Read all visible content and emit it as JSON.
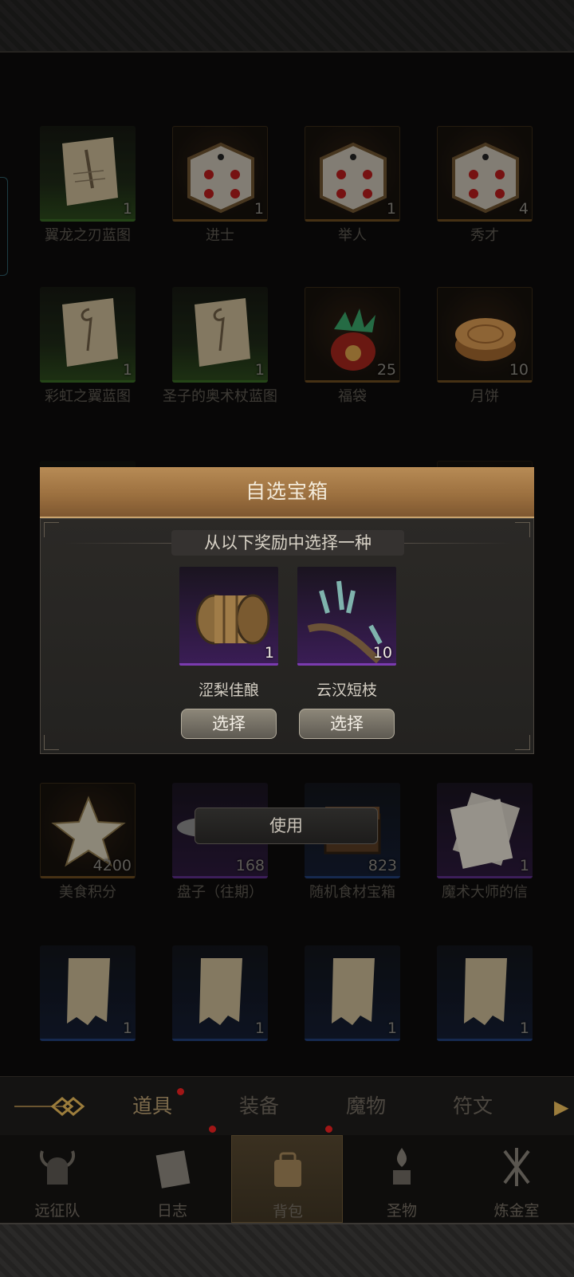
{
  "grid": {
    "items": [
      {
        "name": "翼龙之刃蓝图",
        "count": "1",
        "rarity": "green",
        "icon": "scroll-icon"
      },
      {
        "name": "进士",
        "count": "1",
        "rarity": "gold",
        "icon": "dice-icon"
      },
      {
        "name": "举人",
        "count": "1",
        "rarity": "gold",
        "icon": "dice-icon"
      },
      {
        "name": "秀才",
        "count": "4",
        "rarity": "gold",
        "icon": "dice-icon"
      },
      {
        "name": "彩虹之翼蓝图",
        "count": "1",
        "rarity": "green",
        "icon": "scroll-icon"
      },
      {
        "name": "圣子的奥术杖蓝图",
        "count": "1",
        "rarity": "green",
        "icon": "scroll-icon"
      },
      {
        "name": "福袋",
        "count": "25",
        "rarity": "gold",
        "icon": "lucky-bag-icon"
      },
      {
        "name": "月饼",
        "count": "10",
        "rarity": "gold",
        "icon": "mooncake-icon"
      },
      {
        "name": "美食积分",
        "count": "4200",
        "rarity": "gold",
        "icon": "star-icon"
      },
      {
        "name": "盘子（往期）",
        "count": "168",
        "rarity": "purple",
        "icon": "plate-icon"
      },
      {
        "name": "随机食材宝箱",
        "count": "823",
        "rarity": "blue",
        "icon": "chest-icon"
      },
      {
        "name": "魔术大师的信",
        "count": "1",
        "rarity": "purple",
        "icon": "letter-icon"
      },
      {
        "name": "",
        "count": "1",
        "rarity": "blue",
        "icon": "parchment-icon"
      },
      {
        "name": "",
        "count": "1",
        "rarity": "blue",
        "icon": "parchment-icon"
      },
      {
        "name": "",
        "count": "1",
        "rarity": "blue",
        "icon": "parchment-icon"
      },
      {
        "name": "",
        "count": "1",
        "rarity": "blue",
        "icon": "parchment-icon"
      }
    ]
  },
  "dialog": {
    "title": "自选宝箱",
    "subtitle": "从以下奖励中选择一种",
    "rewards": [
      {
        "name": "涩梨佳酿",
        "count": "1",
        "icon": "barrel-icon",
        "button": "选择"
      },
      {
        "name": "云汉短枝",
        "count": "10",
        "icon": "branch-icon",
        "button": "选择"
      }
    ]
  },
  "use_button": "使用",
  "category_tabs": [
    {
      "label": "道具",
      "active": true,
      "badge": true
    },
    {
      "label": "装备",
      "active": false,
      "badge": false
    },
    {
      "label": "魔物",
      "active": false,
      "badge": false
    },
    {
      "label": "符文",
      "active": false,
      "badge": false
    }
  ],
  "bottom_nav": [
    {
      "label": "远征队",
      "icon": "helmet-icon",
      "active": false,
      "badge": false
    },
    {
      "label": "日志",
      "icon": "journal-icon",
      "active": false,
      "badge": true
    },
    {
      "label": "背包",
      "icon": "backpack-icon",
      "active": true,
      "badge": true
    },
    {
      "label": "圣物",
      "icon": "relic-icon",
      "active": false,
      "badge": false
    },
    {
      "label": "炼金室",
      "icon": "alchemy-icon",
      "active": false,
      "badge": false
    }
  ],
  "colors": {
    "accent_gold": "#9d7140",
    "rarity_green": "#3a6a25",
    "rarity_gold": "#6c4c1f",
    "rarity_purple": "#7b3bb0",
    "rarity_blue": "#23407a",
    "badge_red": "#a11616"
  }
}
